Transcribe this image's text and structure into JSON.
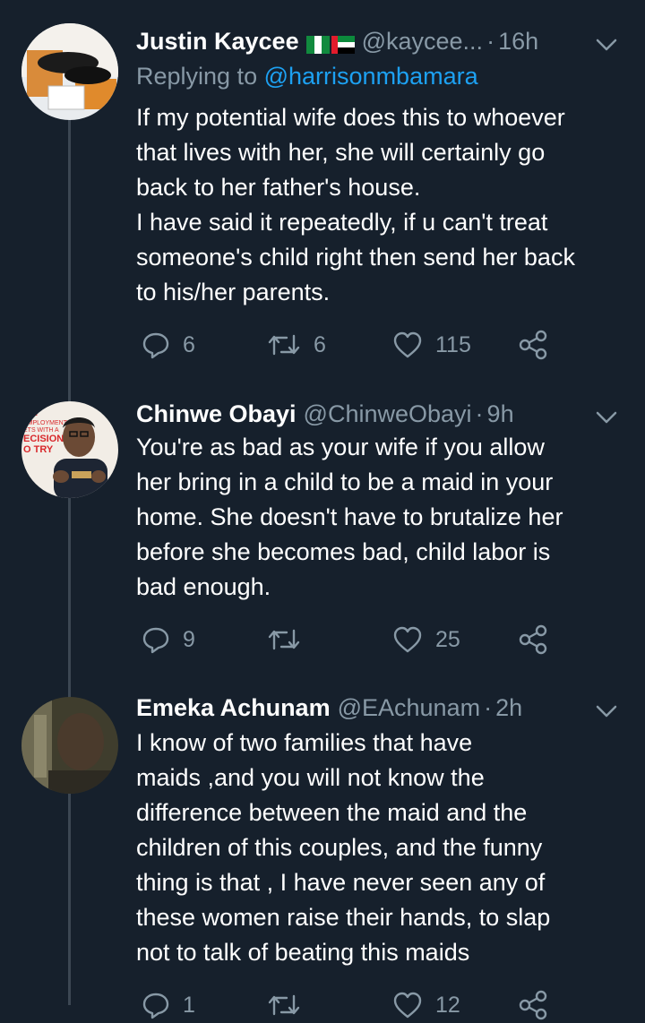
{
  "tweets": [
    {
      "name": "Justin Kaycee",
      "flags": [
        "nigeria-flag",
        "uae-flag"
      ],
      "handle": "@kaycee...",
      "separator": "·",
      "time": "16h",
      "replying_prefix": "Replying to",
      "replying_to": "@harrisonmbamara",
      "lines": [
        "If my potential wife does this to whoever",
        "that lives with her, she will certainly go",
        "back to her father's house.",
        "I have said it repeatedly, if u can't treat",
        "someone's child right then send her back",
        "to his/her parents."
      ],
      "replies": "6",
      "retweets": "6",
      "likes": "115"
    },
    {
      "name": "Chinwe Obayi",
      "handle": "@ChinweObayi",
      "separator": "·",
      "time": "9h",
      "avatar_text": [
        "RY",
        "EMPLOYMENT",
        "ETS WITH A",
        "ECISION",
        "O TRY"
      ],
      "lines": [
        "You're as bad as your wife if you allow",
        "her bring in a child to be a maid in your",
        "home. She doesn't have to brutalize her",
        "before she becomes bad, child labor is",
        "bad enough."
      ],
      "replies": "9",
      "retweets": "",
      "likes": "25"
    },
    {
      "name": "Emeka Achunam",
      "handle": "@EAchunam",
      "separator": "·",
      "time": "2h",
      "lines": [
        "I know of two families that have",
        "maids ,and you will not know the",
        "difference between the maid and the",
        "children of this couples, and the funny",
        "thing is that , I have never seen any of",
        "these women raise their hands, to slap",
        "not to talk of beating this maids"
      ],
      "replies": "1",
      "retweets": "",
      "likes": "12"
    }
  ],
  "colors": {
    "background": "#16202c",
    "text": "#ffffff",
    "muted": "#8899a6",
    "link": "#1da1f2",
    "thread_line": "#3c4753"
  }
}
